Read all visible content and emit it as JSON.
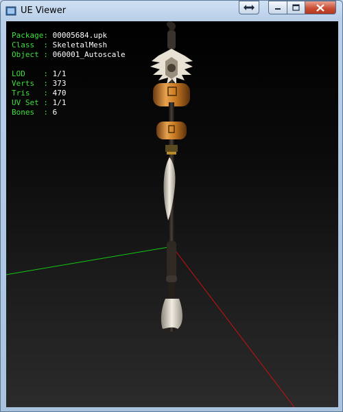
{
  "window": {
    "title": "UE Viewer"
  },
  "info": {
    "package": {
      "label": "Package: ",
      "value": "00005684.upk"
    },
    "class": {
      "label": "Class  : ",
      "value": "SkeletalMesh"
    },
    "object": {
      "label": "Object : ",
      "value": "060001_Autoscale"
    },
    "lod": {
      "label": "LOD    : ",
      "value": "1/1"
    },
    "verts": {
      "label": "Verts  : ",
      "value": "373"
    },
    "tris": {
      "label": "Tris   : ",
      "value": "470"
    },
    "uvset": {
      "label": "UV Set : ",
      "value": "1/1"
    },
    "bones": {
      "label": "Bones  : ",
      "value": "6"
    }
  },
  "colors": {
    "label": "#3ee03e",
    "value": "#ffffff",
    "axis_x": "#cc1010",
    "axis_y": "#10cc10"
  },
  "icons": {
    "app": "ue-viewer-icon",
    "extra": "double-arrow-icon",
    "minimize": "minimize-icon",
    "maximize": "maximize-icon",
    "close": "close-icon"
  }
}
